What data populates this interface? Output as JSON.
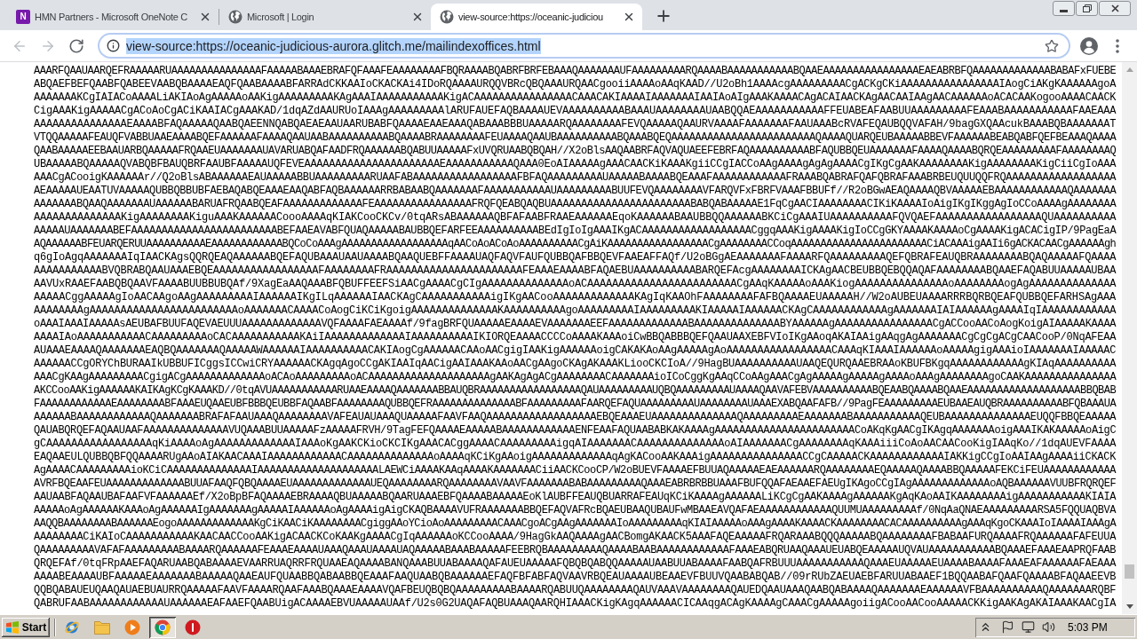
{
  "browser": {
    "tabs": [
      {
        "kind": "notebook",
        "icon_text": "N",
        "title": "HMN Partners - Microsoft OneNote C",
        "selected": false
      },
      {
        "kind": "page",
        "title": "Microsoft | Login",
        "selected": false
      },
      {
        "kind": "page",
        "title": "view-source:https://oceanic-judiciou",
        "selected": true
      }
    ],
    "nav_buttons": [
      {
        "kind": "back",
        "disabled": true
      },
      {
        "kind": "forward",
        "disabled": true
      },
      {
        "kind": "reload",
        "disabled": false
      }
    ],
    "address_bar": {
      "url": "view-source:https://oceanic-judicious-aurora.glitch.me/mailindexoffices.html",
      "text_selected": true
    }
  },
  "source_lines": [
    "AAARFQAAUAARQEFRAAAAARUAAAAAAAAAAAAAAAFAAAAABAAAEBRAFQFAAAFEAAAAAAAAFBQRAAAABQABRFBRFEBAAAQAAAAAAAUFAAAAAAAAARQAAAABAAAAAAAAAAABQAAEAAAAAAAAAAAAAAAAEAEABRBFQAAAAAAAAAAAAABABAFxFUEBE",
    "ABQAEFBEFQAABFQABEEVAABQBAAAAEAQFQAABAAAABFARRAdCKKAAIoCKACKAi4IDoRQAAAAURQQVBRcQBQAAAURQAACgooiiAAAAoAAqKAAD//U2oBh1AAAAcgAAAAAAAAACgACKgCKiAAAAAAAAAAAAAAAAIAogCiAKgKAAAAAAgoA",
    "AAAAAAAKCgIAIACoAAAALiAKIAoAgAAAAAoAAKigAAAAAAAAAKAgAAAIAAAAAAAAAAAKigACAAAAAAAAAAAAAAAACAAACAKIAAAAIAAAAAAAIAAIAoAIgAAAKAAAACAgACAIAACKAgAACAAIAAgAACAAAAAAoACACAAKogooAAAACAACK",
    "CigAAAKigAAAAACgACoAoCgACiKAAIACgAAAKAD/1dqAZdAAURUoIAAAgAAAAAAAAAlARUFAUEFAQBAAAAUEVAAAAAAAAAABAAAUAAAAAAAAUAABQQAEAAAAAAAAAAAFFEUABEAFAABUUAAAAAAAAAFEAAABAAAAAAAAAAAFAAEAAA",
    "AAAAAAAAAAAAAAAEAAAABFAQAAAAAQAABQAEENNQABQAEAEAAUAARUBABFQAAAAEAAEAAAQABAAABBBUAAAAARQAAAAAAAAFEVQAAAAAQAAURVAAAAFAAAAAAAFAAUAAABcRVAFEQAUBQQVAFAH/9bagGXQAAcukBAAABQBAAAAAAAT",
    "VTQQAAAAAFEAUQFVABBUAAEAAAABQEFAAAAAAFAAAAQAAUAABAAAAAAAAAABQAAAABRAAAAAAAAFEUAAAAQAAUBAAAAAAAAAABQAAABQEQAAAAAAAAAAAAAAAAAAAAAAAAQAAAAQUARQEUBAAAAABBEVFAAAAAABEABQABFQEFBEAAAQAAAA",
    "QAABAAAAAEEBAAUARBQAAAAAFRQAAEUAAAAAAAUAVARUABQAFAADFRQAAAAAABQABUUAAAAAFxUVQRUAABQBQAH//X2oBlsAAQAABRFAQVAQUAEEFEBRFAQAAAAAAAAAABFAQUBBQEUAAAAAAAFAAAAQAAAABQRQEAAAAAAAAAFAAAAAAAAQ",
    "UBAAAAABQAAAAAQVABQBFBAUQBRFAAUBFAAAAAUQFEVEAAAAAAAAAAAAAAAAAAAAAAEAAAAAAAAAAAQAAA0EoAIAAAAAgAAACAACKiKAAAKgiiCCgIACCoAAgAAAAgAgAgAAAACgIKgCgAAKAAAAAAAAKigAAAAAAAAKigCiiCgIoAAA",
    "AAACgACooigKAAAAAAr//Q2oBlsABAAAAAAEAUAAAAABBUAAAAAAAAARUAAFABAAAAAAAAAAAAAAAAAFBFAQAAAAAAAAAUAAAAABAAAABQEAAAFAAAAAAAAAAAAFRAAABQABRAFQAFQBRAFAAABRBEUQUUQQFRQAAAAAAAAAAAAAAAAAA",
    "AEAAAAAUEAATUVAAAAAQUBBQBBUBFAEBAQABQEAAAEAAQABFAQBAAAAAARRBABAABQAAAAAAAFAAAAAAAAAAAUAAAAAAAAABUUFEVQAAAAAAAAVFARQVFxFBRFVAAAFBBUFf//R2oBGwAEAQAAAAQBVAAAAAEBAAAAAAAAAAAAQAAAAAAA",
    "AAAAAAABQAAQAAAAAAAUAAAAAABARUAFRQAABQEAFAAAAAAAAAAAAAFEAAAAAAAAAAAAAAAAFRQFQEABQAQBUAAAAAAAAAAAAAAAAAAAAAAABABQABAAAAAE1FqCgAACIAAAAAAAACIKiKAAAAIoAigIKgIKggAgIoCCoAAAAgAAAAAAAA",
    "AAAAAAAAAAAAAAKigAAAAAAAAKiguAAAKAAAAAACoooAAAAqKIAKCooCKCv/0tqARsABAAAAAAQBFAFAABFRAAEAAAAAAEqoKAAAAAABAAUBBQQAAAAAABKCiCgAAAIUAAAAAAAAAAFQVQAEFAAAAAAAAAAAAAAAAAQUAAAAAAAAAA",
    "AAAAAUAAAAAAABEFAAAAAAAAAAAAAAAAAAAAAAAABEFAAEAVABFQUAQAAAAABAUBBQEFARFEEAAAAAAAAAABEdIgIoIgAAAIKgACAAAAAAAAAAAAAAAAAACggqAAAKigAAAAKigIoCCgGKYAAAAKAAAAoCgAAAAKigACACigIP/9PagEaA",
    "AQAAAAAABFEUARQERUUAAAAAAAAAAEAAAAAAAAAAAABQCoCoAAAgAAAAAAAAAAAAAAAAAAqAACoAoACoAoAAAAAAAAAACgAiKAAAAAAAAAAAAAAAAACgAAAAAAAACCoqAAAAAAAAAAAAAAAAAAAAAAACiACAAAigAAIi6gACKACAACgAAAAAAgh",
    "q6gIoAgqAAAAAAAIqIAACKAgsQQRQEAQAAAAAABQEFAQUBAAAUAAUAAAABQAAQUEBFFAAAAUAQFAQVFAUFQUBBQAFBBQEVFAAEAFFAQf/U2oBGgAEAAAAAAAFAAAARFQAAAAAAAAAQEFQBRAFEAUQBRAAAAAAAABQAQAAAAAFQAAAA",
    "AAAAAAAAAAABVQBRABQAAUAAAEBQEAAAAAAAAAAAAAAAAAFAAAAAAAAFRAAAAAAAAAAAAAAAAAAAAAAFEAAAEAAAABFAQAEBUAAAAAAAAAABARQEFAcgAAAAAAAAICKAgAACBEUBBQEBQQAQAFAAAAAAAABQAAEFAQABUUAAAAAUBAA",
    "AAVUxRAAEFAABQBQAAVFAAAABUUBBUBQAf/9XagEaAAQAAABFQBUFFEEFSiAACgAAAACgCIgAAAAAAAAAAAAAAoACAAAAAAAAAAAAAAAAAAAAAAAACgAAqKAAAAAoAAAKiogAAAAAAAAAAAAAAAoAAAAAAAAogAgAAAAAAAAAAAAAA",
    "AAAAACggAAAAAgIoAACAAgoAAgAAAAAAAAAIAAAAAAIKgILqAAAAAAIAACKAgCAAAAAAAAAAAigIKgAACooAAAAAAAAAAAAAKAgIqKAAOhFAAAAAAAAFAFBQAAAAEUAAAAAH//W2oAUBEUAAAARRRBQRBQEAFQUBBQEFARHSAgAAA",
    "AAAAAAAAgAAAAAAAAAAAAAAAAAAAAAAAAoAAAAAAACAAAACoAogCiKCiKgoigAAAAAAAAAAAAAAKAAAAAAAAAAgoAAAAAAAAAIAAAAAAAAAKIAAAAAIAAAAAACKAgCAAAAAAAAAAAAgAAAAAAAIAIAAAAAAgAAAAIqIAAAAAAAAAAAA",
    "oAAAIAAAIAAAAAsAEUBAFBUUFAQEVAEUUUAAAAAAAAAAAAAVQFAAAAFAEAAAAf/9fagBRFQUAAAAAEAAAAEVAAAAAAAEEFAAAAAAAAAAAAABAAAAAAAAAAAAAABYAAAAAAgAAAAAAAAAAAAAAAACgACCooAACoAogKoigAIAAAAAKAAAA",
    "AAAAIAoAAAAAAAAAAACAAAAAAAAAoCACAAAAAAAAAAAKAiIAAAAAAAAAAAAAIAAAAAAAAAAIKIORQEAAAACCCCoAAAAKAAAoiCwBBQABBBQEFQAAUAAXEBFVIoIKgAAoqAKAIAAigAAqgAgAAAAAAACgCgCgACgCAACooP/0NqAFEAA",
    "AUAAAEAAAAQAAAAAAAEAQBQAAAAAAAQAAAAAWAAAAAAIAAAAAAAAAACAKIAogCgAAAAAACAAoAACgigIAAKigAAAAAAoigCAKAKAoAAgAAAAAgAoAAAAAAAAAAAAAAAAACAAAqKIAAAIAAAAAAoAAAAAgigAAAioIAAAAAAAIAAAAAC",
    "AAAAAACCgORYChBURAAIkUBBUFICggsICCwiCRYAAAAAACKAgqAgoCCgAKIAAIqAACigAAIAAAKAAoAACgAAgoCKAgAKAAAKLiooCKCIoA//9HagBUAAAAAAAAAAUAAQEQURQAAEBRAAoKBUFBKgqAAAAAAAAAAAAgKIAqAAAAAAAAAA",
    "AAACgKAAgAAAAAAAAACgigACgAAAAAAAAAAAAAoACAoAAAAAAAAAoACAAAAAAAAAAAAAAAAAAAAgAAKAgAgACgAAAAAAAACAAAAAAAioICoCggKgAAqCCoAAgAAACgAgAAAAAgAAAAAgAAAAoAAAgAAAAAAAAgoCAAKAAAAAAAAAAAAAAA",
    "AKCCooAAKigAAAAAAKAIKAgKCgKAAAKD//0tqAVUAAAAAAAAAAARUAAEAAAAQAAAAAAABBAUQBRAAAAAAAAAAAAAAAAAQAUAAAAAAAAAUQBQAAAAAAAAAUAAAAQAAVAFEBVAAAAAAAAAABQEAABQAAAABQAAEAAAAAAAAAAAAAAAAAAABBQBAB",
    "FAAAAAAAAAAAAEAAAAAAAABFAAAEUQAAEUBFBBBQEUBBFAQAABFAAAAAAAAQUBBQEFRAAAAAAAAAAAAAABFAAAAAAAAAFAARQEFAQUAAAAAAAAAUAAAAAAAAUAAAEXABQAAFAFB//9PagFEAAAAAAAAAEUBAAEAUQBRAAAAAAAAAABFQBAAAUA",
    "AAAAAABAAAAAAAAAAAAQAAAAAAABRAFAFAAUAAAQAAAAAAAAVAFEAUAUAAAQUAAAAAFAAVFAAQAAAAAAAAAAAAAAAAAAEBQEAAAEUAAAAAAAAAAAAAAQAAAAAAAAAEAAAAAAABAAAAAAAAAAAQEUBAAAAAAAAAAAAAAEUQQFBBQEAAAAA",
    "QAUABQRQEFAQAAUAAFAAAAAAAAAAAAAAVUQAAABUUAAAAAFzAAAAAFRVH/9TagFEFQAAAAEAAAAABAAAAAAAAAAAAENFEAAFAQUAABABKAKAAAAgAAAAAAAAAAAAAAAAAAAAAAACoAKqKgAACgIKAgqAAAAAAAoigAAAIKAKAAAAAoAigC",
    "gCAAAAAAAAAAAAAAAAAqKiAAAAoAgAAAAAAAAAAAAAIAAAoKgAAKCKioCKCIKgAAACACggAAAACAAAAAAAAAigqAIAAAAAAACAAAAAAAAAAAAAAoAIAAAAAAACgAAAAAAAAqKAAAiiiCoAoAACAACooKigIAAqKo//1dqAUEVFAAAA",
    "EAQAAEULQUBBQBFQQAAAARUgAAoAIAKAACAAAIAAAAAAAAAAAACAAAAAAAAAAAAAAoAAAAqKCiKgAAoigAAAAAAAAAAAAAqAgKACooAAKAAAigAAAAAAAAAAAAAAACCgCAAAAACKAAAAAAAAAAAAIAKKigCCgIoAAIAAgAAAAiiCKACK",
    "AgAAAACAAAAAAAAAioKCiCAAAAAAAAAAAAAAIAAAAAAAAAAAAAAAAAAAALAEWCiAAAAKAAqAAAAKAAAAAAACiiAACKCooCP/W2oBUEVFAAAAEFBUUAQAAAAAEAEAAAAAARQAAAAAAAAEQAAAAAQAAAABBQAAAAAFEKCiFEUAAAAAAAAAAAA",
    "AVRFBQEAAFEUAAAAAAAAAAAAABUUAFAAQFQBQAAAAEUAAAAAAAAAAAAAUEQAAAAAAAARQAAAAAAAAVAAVFAAAAAAABABAAAAAAAAAQAAAEABRBRBBUAAAFBUFQQAFAEAAEFAEUgIKAgoCCgIAgAAAAAAAAAAAAAoAQBAAAAAAVUUBFRQRQEF",
    "AAUAABFAQAAUBAFAAFVFAAAAAAEf/X2oBpBFAQAAAAEBRAAAAQBUAAAAABQAARUAAAEBFQAAAABAAAAAEoKlAUBFFEAUQBUARRAFEAUqKCiKAAAAgAAAAAALiKCgCgAAKAAAAgAAAAAAKgAqKAoAAIKAAAAAAAAigAAAAAAAAAAAKIAIA",
    "AAAAAoAgAAAAAAKAAAoAgAAAAAAIgAAAAAAAgAAAAAIAAAAAAoAgAAAAigAigCKAQBAAAAVUFRAAAAAAABBQEFAQVAFRcBQAEUBAAQUBAUFwMBAAEAVQAFAEAAAAAAAAAAAAQUUMUAAAAAAAAAf/0NqAaQNAEAAAAAAAAARSA5FQQUAQBVA",
    "AAQQBAAAAAAAABAAAAAAEogoAAAAAAAAAAAAAKgCiKAACiKAAAAAAAACgiggAAoYCioAoAAAAAAAAACAAACgoACgAAgAAAAAAAIoAAAAAAAAAqKIAIAAAAAoAAAgAAAAKAAAACKAAAAAAAACACAAAAAAAAAAgAAAqKgoCKAAAIoIAAAAIAAAgA",
    "AAAAAAAACiKAIoCAAAAAAAAAAAKAACAACCooAAKigACAACKCoKAAKgAAAACgIqAAAAAAoKCCooAAAA/9HagGkAAQAAAAgAACBomgAKAACK5AAAFAQEAAAAAFRQARAAABQQQAAAAABQAAAAAAAAFBABAAFURQAAAAFRQAAAAAAFAFEUUA",
    "QAAAAAAAAAVAFAFAAAAAAAAABAAAARQAAAAAAFEAAAEAAAAUAAAQAAAUAAAAUAQAAAAABAAABAAAAAFEEBRQBAAAAAAAAAQAAAABAABAAAAAAAAAAAAFAAAEABQRUAAQAAAUEUABQEAAAAAUQVAUAAAAAAAAAAABQAAAEFAAAEAAPRQFAAB",
    "QRQEFAf/0tqFRpAAEFAQARUAABQABAAAAEVAARRUAQRRFRQUAAEAQAAAABANQAAABUUABAAAAQAFAUEUAAAAAFQBQBQABQQAAAAAUAABUUABAAAAFAABQAFRBUUUAAAAAAAAAAAQAAAEUAAAAAEUAAAABAAAAFAAAEAFAAAAAAFAEAAA",
    "AAAABEAAAAUBFAAAAAEAAAAAAABAAAAAQAAEAUFQUAABBQABAABBQEAAAFAAQUAABQBAAAAAAEFAQFBFABFAQVAAVRBQEAUAAAAUBEAAEVFBUUVQAABABQAB//09rRUbZAEUAEBFARUUABAAEF1BQQAABAFQAAFQAAAABFAQAAEEVB",
    "QQBQABAUEUQAAQAUAEBUAURRQAAAAAFAAVFAAAARQAAFAAABQAAAEAAAAVQAFBEUQBQBQAAAAAAAAABAAAARQABUUQAAAAAAAAQAUVAAAVAAAAAAAAQAUEDQAAUAAAQAABQABAAAAQAAAAAAAEAAAAAAVFBAAAAAAAAAAQAAAAAAARQBF",
    "QABRUFAABAAAAAAAAAAAAUAAAAAAEAFAAEFQAABUigACAAAAEBVUAAAAAUAAf/U2s0G2UAQAFAQBUAAAQAARQHIAAACKigKAgqAAAAAACICAAqgACAgKAAAAgCAAACgAAAAAgoiigACooAACooAAAAACKKigAAKAgAKAIAAAKAACgIA"
  ],
  "taskbar": {
    "start": "Start",
    "apps": [
      {
        "kind": "ring_globe",
        "selected": false
      },
      {
        "kind": "folder",
        "selected": false
      },
      {
        "kind": "media",
        "selected": false
      },
      {
        "kind": "round",
        "selected": true
      },
      {
        "kind": "alert",
        "selected": false
      }
    ],
    "clock": "5:03 PM"
  }
}
